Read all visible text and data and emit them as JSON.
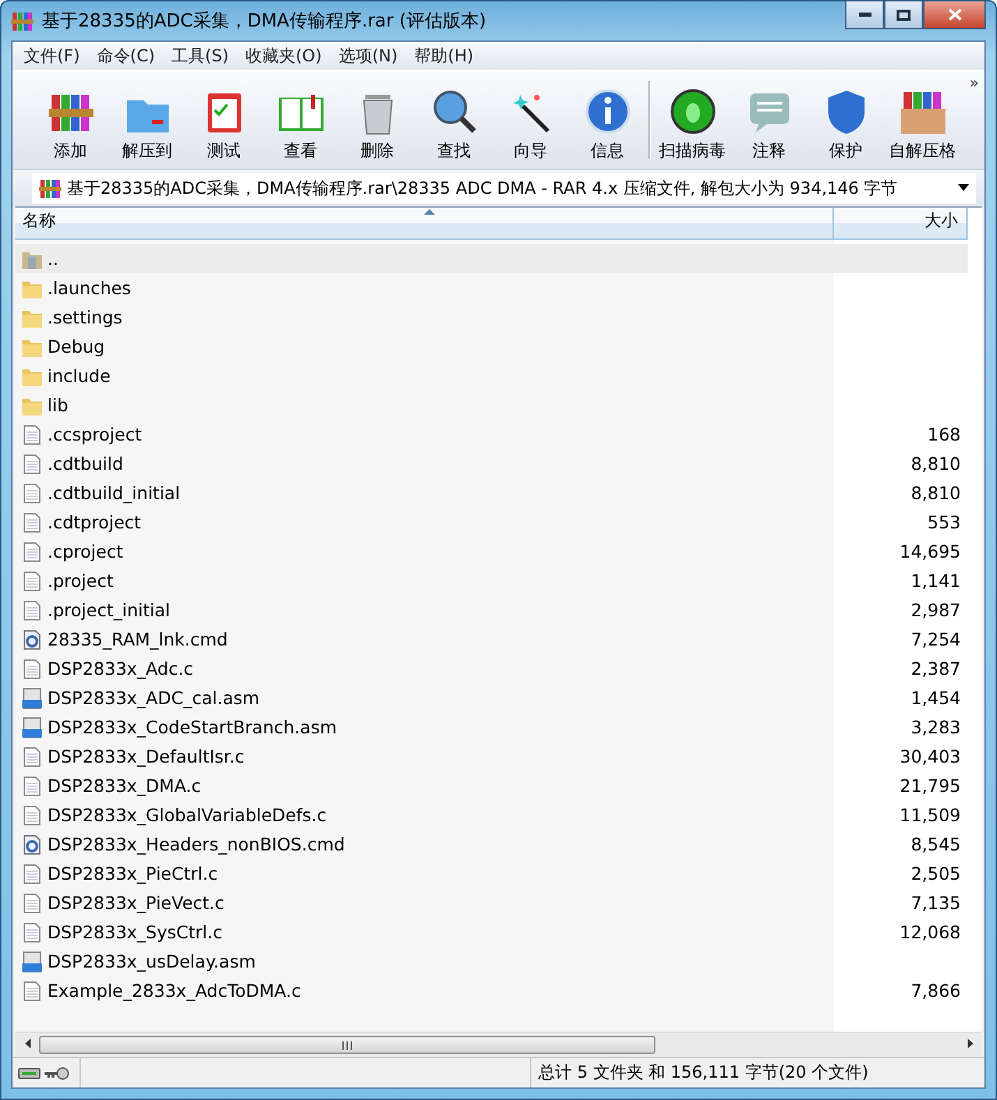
{
  "window": {
    "title": "基于28335的ADC采集，DMA传输程序.rar (评估版本)"
  },
  "menu": [
    "文件(F)",
    "命令(C)",
    "工具(S)",
    "收藏夹(O)",
    "选项(N)",
    "帮助(H)"
  ],
  "toolbar": [
    {
      "label": "添加",
      "separator_before": false
    },
    {
      "label": "解压到",
      "separator_before": false
    },
    {
      "label": "测试",
      "separator_before": false
    },
    {
      "label": "查看",
      "separator_before": false
    },
    {
      "label": "删除",
      "separator_before": false
    },
    {
      "label": "查找",
      "separator_before": false
    },
    {
      "label": "向导",
      "separator_before": false
    },
    {
      "label": "信息",
      "separator_before": false
    },
    {
      "label": "扫描病毒",
      "separator_before": true
    },
    {
      "label": "注释",
      "separator_before": false
    },
    {
      "label": "保护",
      "separator_before": false
    },
    {
      "label": "自解压格",
      "separator_before": false
    }
  ],
  "toolbar_overflow": "»",
  "address": "基于28335的ADC采集，DMA传输程序.rar\\28335 ADC DMA - RAR 4.x 压缩文件, 解包大小为 934,146 字节",
  "table": {
    "columns": [
      "名称",
      "大小"
    ],
    "rows": [
      {
        "kind": "parent",
        "name": "..",
        "size": "",
        "selected": true
      },
      {
        "kind": "folder",
        "name": ".launches",
        "size": "",
        "selected": false
      },
      {
        "kind": "folder",
        "name": ".settings",
        "size": "",
        "selected": false
      },
      {
        "kind": "folder",
        "name": "Debug",
        "size": "",
        "selected": false
      },
      {
        "kind": "folder",
        "name": "include",
        "size": "",
        "selected": false
      },
      {
        "kind": "folder",
        "name": "lib",
        "size": "",
        "selected": false
      },
      {
        "kind": "file",
        "name": ".ccsproject",
        "size": "168",
        "selected": false
      },
      {
        "kind": "file",
        "name": ".cdtbuild",
        "size": "8,810",
        "selected": false
      },
      {
        "kind": "file",
        "name": ".cdtbuild_initial",
        "size": "8,810",
        "selected": false
      },
      {
        "kind": "file",
        "name": ".cdtproject",
        "size": "553",
        "selected": false
      },
      {
        "kind": "file",
        "name": ".cproject",
        "size": "14,695",
        "selected": false
      },
      {
        "kind": "file",
        "name": ".project",
        "size": "1,141",
        "selected": false
      },
      {
        "kind": "file",
        "name": ".project_initial",
        "size": "2,987",
        "selected": false
      },
      {
        "kind": "cmd",
        "name": "28335_RAM_lnk.cmd",
        "size": "7,254",
        "selected": false
      },
      {
        "kind": "file",
        "name": "DSP2833x_Adc.c",
        "size": "2,387",
        "selected": false
      },
      {
        "kind": "asm",
        "name": "DSP2833x_ADC_cal.asm",
        "size": "1,454",
        "selected": false
      },
      {
        "kind": "asm",
        "name": "DSP2833x_CodeStartBranch.asm",
        "size": "3,283",
        "selected": false
      },
      {
        "kind": "file",
        "name": "DSP2833x_DefaultIsr.c",
        "size": "30,403",
        "selected": false
      },
      {
        "kind": "file",
        "name": "DSP2833x_DMA.c",
        "size": "21,795",
        "selected": false
      },
      {
        "kind": "file",
        "name": "DSP2833x_GlobalVariableDefs.c",
        "size": "11,509",
        "selected": false
      },
      {
        "kind": "cmd",
        "name": "DSP2833x_Headers_nonBIOS.cmd",
        "size": "8,545",
        "selected": false
      },
      {
        "kind": "file",
        "name": "DSP2833x_PieCtrl.c",
        "size": "2,505",
        "selected": false
      },
      {
        "kind": "file",
        "name": "DSP2833x_PieVect.c",
        "size": "7,135",
        "selected": false
      },
      {
        "kind": "file",
        "name": "DSP2833x_SysCtrl.c",
        "size": "12,068",
        "selected": false
      },
      {
        "kind": "asm",
        "name": "DSP2833x_usDelay.asm",
        "size": "",
        "selected": false
      },
      {
        "kind": "file",
        "name": "Example_2833x_AdcToDMA.c",
        "size": "7,866",
        "selected": false
      }
    ]
  },
  "status_bar": {
    "summary": "总计 5 文件夹 和 156,111 字节(20 个文件)"
  }
}
